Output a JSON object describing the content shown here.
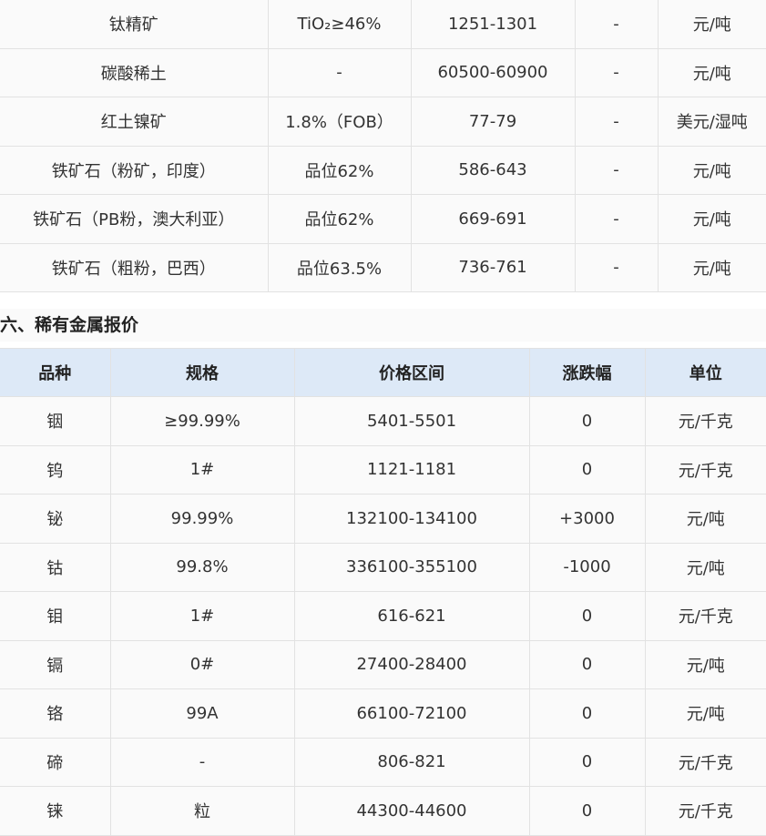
{
  "ore_table": {
    "rows": [
      [
        "钛精矿",
        "TiO₂≥46%",
        "1251-1301",
        "-",
        "元/吨"
      ],
      [
        "碳酸稀土",
        "-",
        "60500-60900",
        "-",
        "元/吨"
      ],
      [
        "红土镍矿",
        "1.8%（FOB）",
        "77-79",
        "-",
        "美元/湿吨"
      ],
      [
        "铁矿石（粉矿，印度）",
        "品位62%",
        "586-643",
        "-",
        "元/吨"
      ],
      [
        "铁矿石（PB粉，澳大利亚）",
        "品位62%",
        "669-691",
        "-",
        "元/吨"
      ],
      [
        "铁矿石（粗粉，巴西）",
        "品位63.5%",
        "736-761",
        "-",
        "元/吨"
      ]
    ]
  },
  "rare_section": {
    "title": "六、稀有金属报价"
  },
  "rare_table": {
    "headers": [
      "品种",
      "规格",
      "价格区间",
      "涨跌幅",
      "单位"
    ],
    "rows": [
      [
        "铟",
        "≥99.99%",
        "5401-5501",
        "0",
        "元/千克"
      ],
      [
        "钨",
        "1#",
        "1121-1181",
        "0",
        "元/千克"
      ],
      [
        "铋",
        "99.99%",
        "132100-134100",
        "+3000",
        "元/吨"
      ],
      [
        "钴",
        "99.8%",
        "336100-355100",
        "-1000",
        "元/吨"
      ],
      [
        "钼",
        "1#",
        "616-621",
        "0",
        "元/千克"
      ],
      [
        "镉",
        "0#",
        "27400-28400",
        "0",
        "元/吨"
      ],
      [
        "铬",
        "99A",
        "66100-72100",
        "0",
        "元/吨"
      ],
      [
        "碲",
        "-",
        "806-821",
        "0",
        "元/千克"
      ],
      [
        "铼",
        "粒",
        "44300-44600",
        "0",
        "元/千克"
      ]
    ]
  }
}
